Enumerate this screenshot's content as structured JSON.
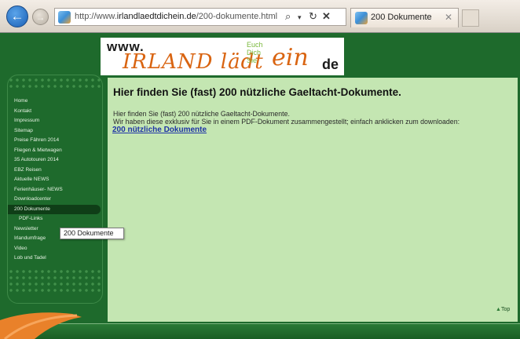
{
  "browser": {
    "url_prefix": "http://www.",
    "url_host": "irlandlaedtdichein.de",
    "url_path": "/200-dokumente.html",
    "tab_title": "200 Dokumente",
    "icons": {
      "back": "arrow-left",
      "forward": "arrow-right",
      "search": "magnifier",
      "dropdown": "chevron-down",
      "refresh": "refresh",
      "stop": "close-x",
      "tab_close": "close-x"
    }
  },
  "banner": {
    "www": "www.",
    "main": "IRLAND lädt",
    "small_lines": [
      "Euch",
      "Dich",
      "Sie"
    ],
    "ein": "ein",
    "de": "de"
  },
  "sidebar": {
    "items": [
      {
        "label": "Home"
      },
      {
        "label": "Kontakt"
      },
      {
        "label": "Impressum"
      },
      {
        "label": "Sitemap"
      },
      {
        "label": "Preise Fähren 2014"
      },
      {
        "label": "Fliegen & Mietwagen"
      },
      {
        "label": "35 Autotouren 2014"
      },
      {
        "label": "EBZ Reisen"
      },
      {
        "label": "Aktuelle NEWS"
      },
      {
        "label": "Ferienhäuser- NEWS"
      },
      {
        "label": "Downloadcenter"
      },
      {
        "label": "200 Dokumente"
      },
      {
        "label": "PDF-Links"
      },
      {
        "label": "Newsletter"
      },
      {
        "label": "Irlandumfrage"
      },
      {
        "label": "Video"
      },
      {
        "label": "Lob und Tadel"
      }
    ],
    "active_index": 11,
    "tooltip": "200 Dokumente"
  },
  "content": {
    "title": "Hier finden Sie (fast) 200 nützliche Gaeltacht-Dokumente.",
    "line1": "Hier finden Sie (fast) 200 nützliche Gaeltacht-Dokumente.",
    "line2": "Wir haben diese exklusiv für Sie in einem PDF-Dokument zusammengestellt; einfach anklicken zum downloaden:",
    "link": "200 nützliche Dokumente",
    "top_link": "Top"
  },
  "colors": {
    "page_green": "#1e6a2c",
    "content_bg": "#c4e6b2",
    "accent_orange": "#d96411",
    "link_blue": "#1f33a6"
  }
}
